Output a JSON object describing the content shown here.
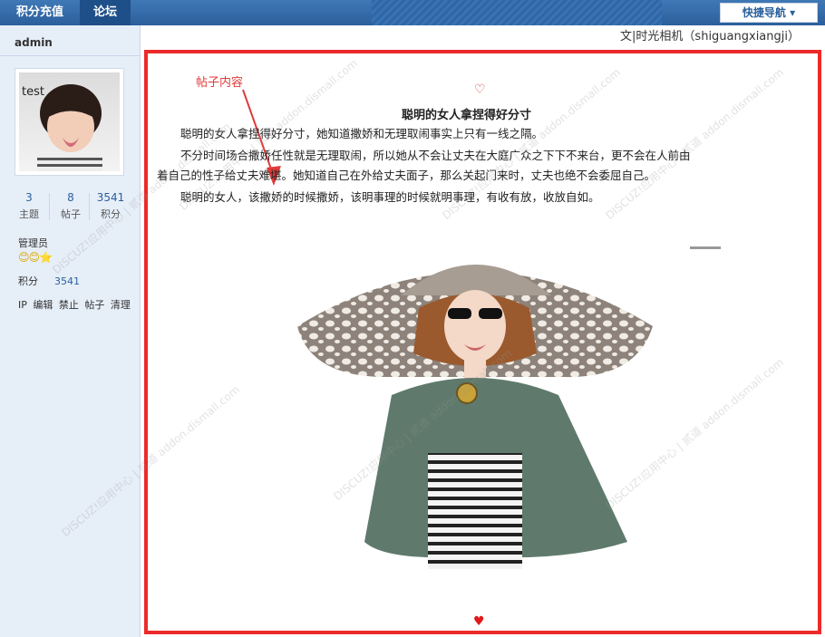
{
  "topnav": {
    "items": [
      {
        "label": "积分充值"
      },
      {
        "label": "论坛"
      }
    ],
    "quick_nav": "快捷导航 ▾"
  },
  "sidebar": {
    "username": "admin",
    "avatar_label": "test",
    "stats": [
      {
        "value": "3",
        "label": "主题"
      },
      {
        "value": "8",
        "label": "帖子"
      },
      {
        "value": "3541",
        "label": "积分"
      }
    ],
    "group": "管理员",
    "stars": "😊😊⭐",
    "credit_label": "积分",
    "credit_value": "3541",
    "actions": [
      "IP",
      "编辑",
      "禁止",
      "帖子",
      "清理"
    ]
  },
  "post": {
    "author_line": "文|时光相机（shiguangxiangji）",
    "annotation": "帖子内容",
    "title": "聪明的女人拿捏得好分寸",
    "paragraphs": [
      "聪明的女人拿捏得好分寸，她知道撒娇和无理取闹事实上只有一线之隔。",
      "不分时间场合撒娇任性就是无理取闹，所以她从不会让丈夫在大庭广众之下下不来台，更不会在人前由",
      "着自己的性子给丈夫难堪。她知道自己在外给丈夫面子，那么关起门来时，丈夫也绝不会委屈自己。",
      "聪明的女人，该撒娇的时候撒娇，该明事理的时候就明事理，有收有放，收放自如。"
    ]
  },
  "watermark": "DISCUZ!应用中心 | 贰道 addon.dismall.com"
}
